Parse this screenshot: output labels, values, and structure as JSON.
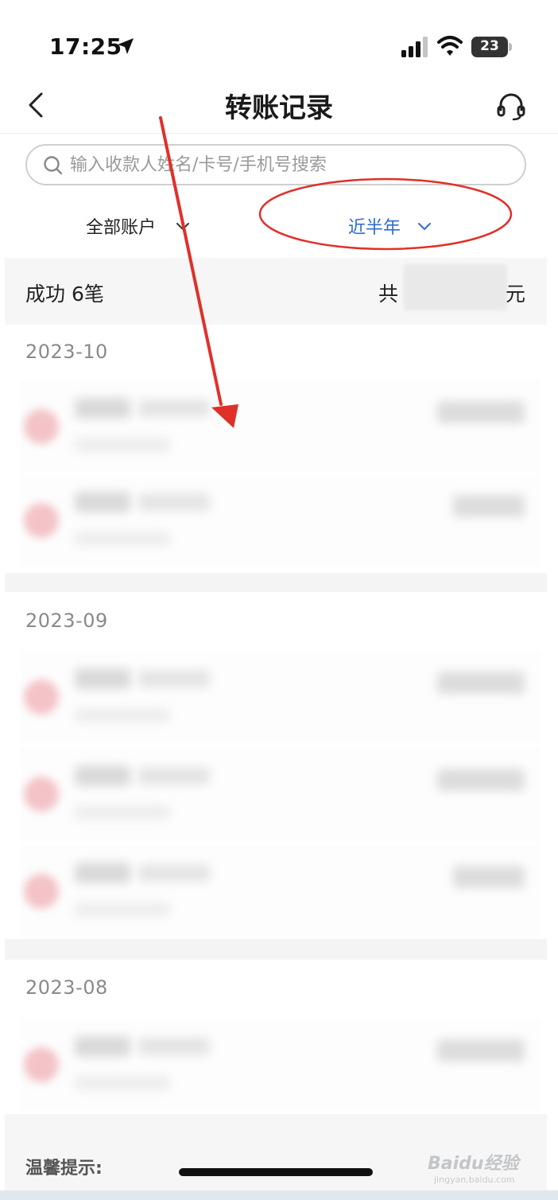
{
  "status_bar": {
    "time": "17:25",
    "battery": "23"
  },
  "nav": {
    "title": "转账记录"
  },
  "search": {
    "placeholder": "输入收款人姓名/卡号/手机号搜索",
    "value": ""
  },
  "filters": {
    "account": "全部账户",
    "period": "近半年",
    "period_color": "#2e6bd2"
  },
  "summary": {
    "success_text": "成功 6笔",
    "total_prefix": "共",
    "total_unit": "元"
  },
  "groups": [
    {
      "month": "2023-10",
      "record_count": 2
    },
    {
      "month": "2023-09",
      "record_count": 3
    },
    {
      "month": "2023-08",
      "record_count": 1
    }
  ],
  "tips": {
    "title": "温馨提示:"
  },
  "watermark": {
    "text": "Baidu经验",
    "sub": "jingyan.baidu.com"
  },
  "annotations": {
    "highlight_color": "#e0302a"
  },
  "icons": {
    "back": "chevron-left-icon",
    "service": "headset-icon",
    "search": "search-icon",
    "dropdown": "chevron-down-icon",
    "location": "location-arrow-icon"
  }
}
